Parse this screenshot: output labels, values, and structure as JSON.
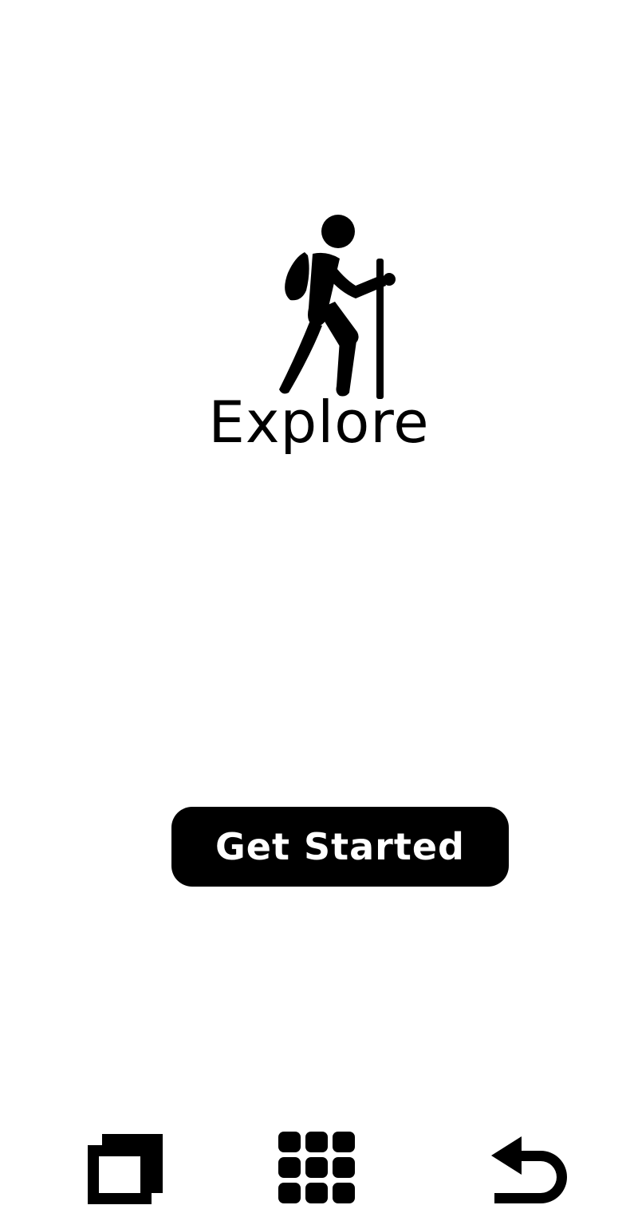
{
  "logo": {
    "text": "Explore",
    "icon": "hiker-icon"
  },
  "main": {
    "get_started_label": "Get Started"
  },
  "nav_bar": {
    "items": [
      {
        "icon": "recents-icon"
      },
      {
        "icon": "apps-grid-icon"
      },
      {
        "icon": "back-icon"
      }
    ]
  },
  "colors": {
    "background": "#ffffff",
    "foreground": "#000000",
    "button_text": "#ffffff"
  }
}
